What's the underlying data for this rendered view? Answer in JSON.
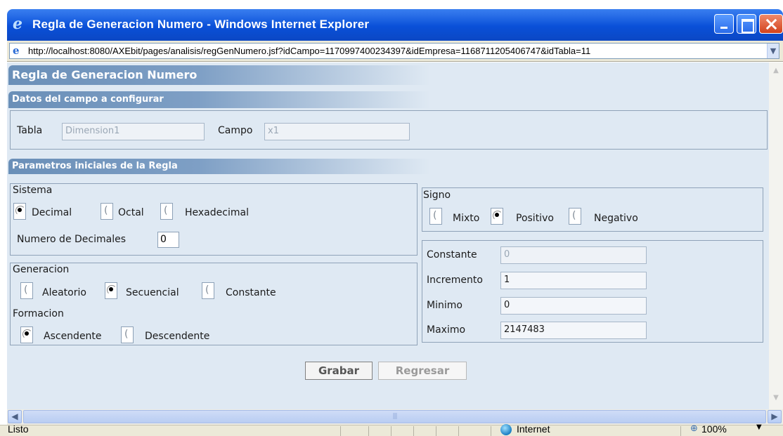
{
  "window": {
    "title": "Regla de Generacion Numero - Windows Internet Explorer"
  },
  "address": {
    "url": "http://localhost:8080/AXEbit/pages/analisis/regGenNumero.jsf?idCampo=1170997400234397&idEmpresa=1168711205406747&idTabla=11"
  },
  "page": {
    "title": "Regla de Generacion Numero",
    "datos_section": "Datos del campo a configurar",
    "tabla_label": "Tabla",
    "tabla_value": "Dimension1",
    "campo_label": "Campo",
    "campo_value": "x1",
    "param_section": "Parametros iniciales de la Regla"
  },
  "sistema": {
    "legend": "Sistema",
    "options": [
      "Decimal",
      "Octal",
      "Hexadecimal"
    ],
    "selected": "Decimal",
    "decimales_label": "Numero de Decimales",
    "decimales_value": "0"
  },
  "generacion": {
    "legend": "Generacion",
    "options": [
      "Aleatorio",
      "Secuencial",
      "Constante"
    ],
    "selected": "Secuencial",
    "formacion_label": "Formacion",
    "formacion_options": [
      "Ascendente",
      "Descendente"
    ],
    "formacion_selected": "Ascendente"
  },
  "signo": {
    "legend": "Signo",
    "options": [
      "Mixto",
      "Positivo",
      "Negativo"
    ],
    "selected": "Positivo"
  },
  "valores": {
    "constante_label": "Constante",
    "constante_value": "0",
    "incremento_label": "Incremento",
    "incremento_value": "1",
    "minimo_label": "Minimo",
    "minimo_value": "0",
    "maximo_label": "Maximo",
    "maximo_value": "2147483"
  },
  "buttons": {
    "grabar": "Grabar",
    "regresar": "Regresar"
  },
  "statusbar": {
    "status": "Listo",
    "zone": "Internet",
    "zoom": "100%"
  }
}
